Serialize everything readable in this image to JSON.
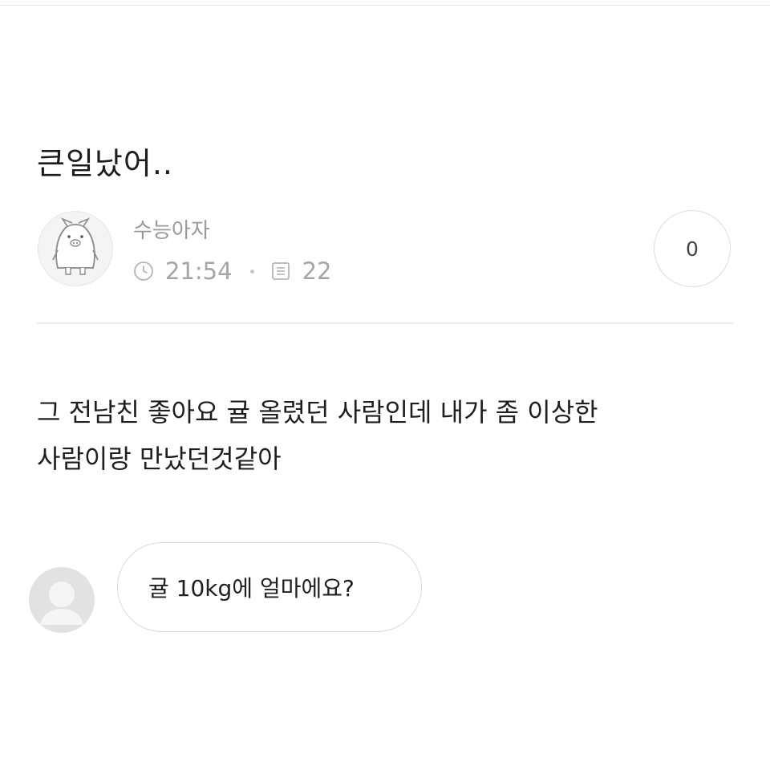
{
  "post": {
    "title": "큰일났어..",
    "author": "수능아자",
    "time": "21:54",
    "views": "22",
    "comment_count": "0",
    "body_lines": [
      "그 전남친 좋아요 귤 올렸던 사람인데 내가 좀 이상한",
      "사람이랑 만났던것같아"
    ]
  },
  "comments": [
    {
      "text": "귤 10kg에 얼마에요?"
    }
  ],
  "icons": {
    "author_avatar": "pig-character-avatar-icon",
    "time": "clock-icon",
    "views": "document-icon",
    "commenter_avatar": "default-user-avatar-icon"
  },
  "colors": {
    "meta_text": "#a5a5a5",
    "title_text": "#1c1c1c",
    "border": "#dadada"
  }
}
